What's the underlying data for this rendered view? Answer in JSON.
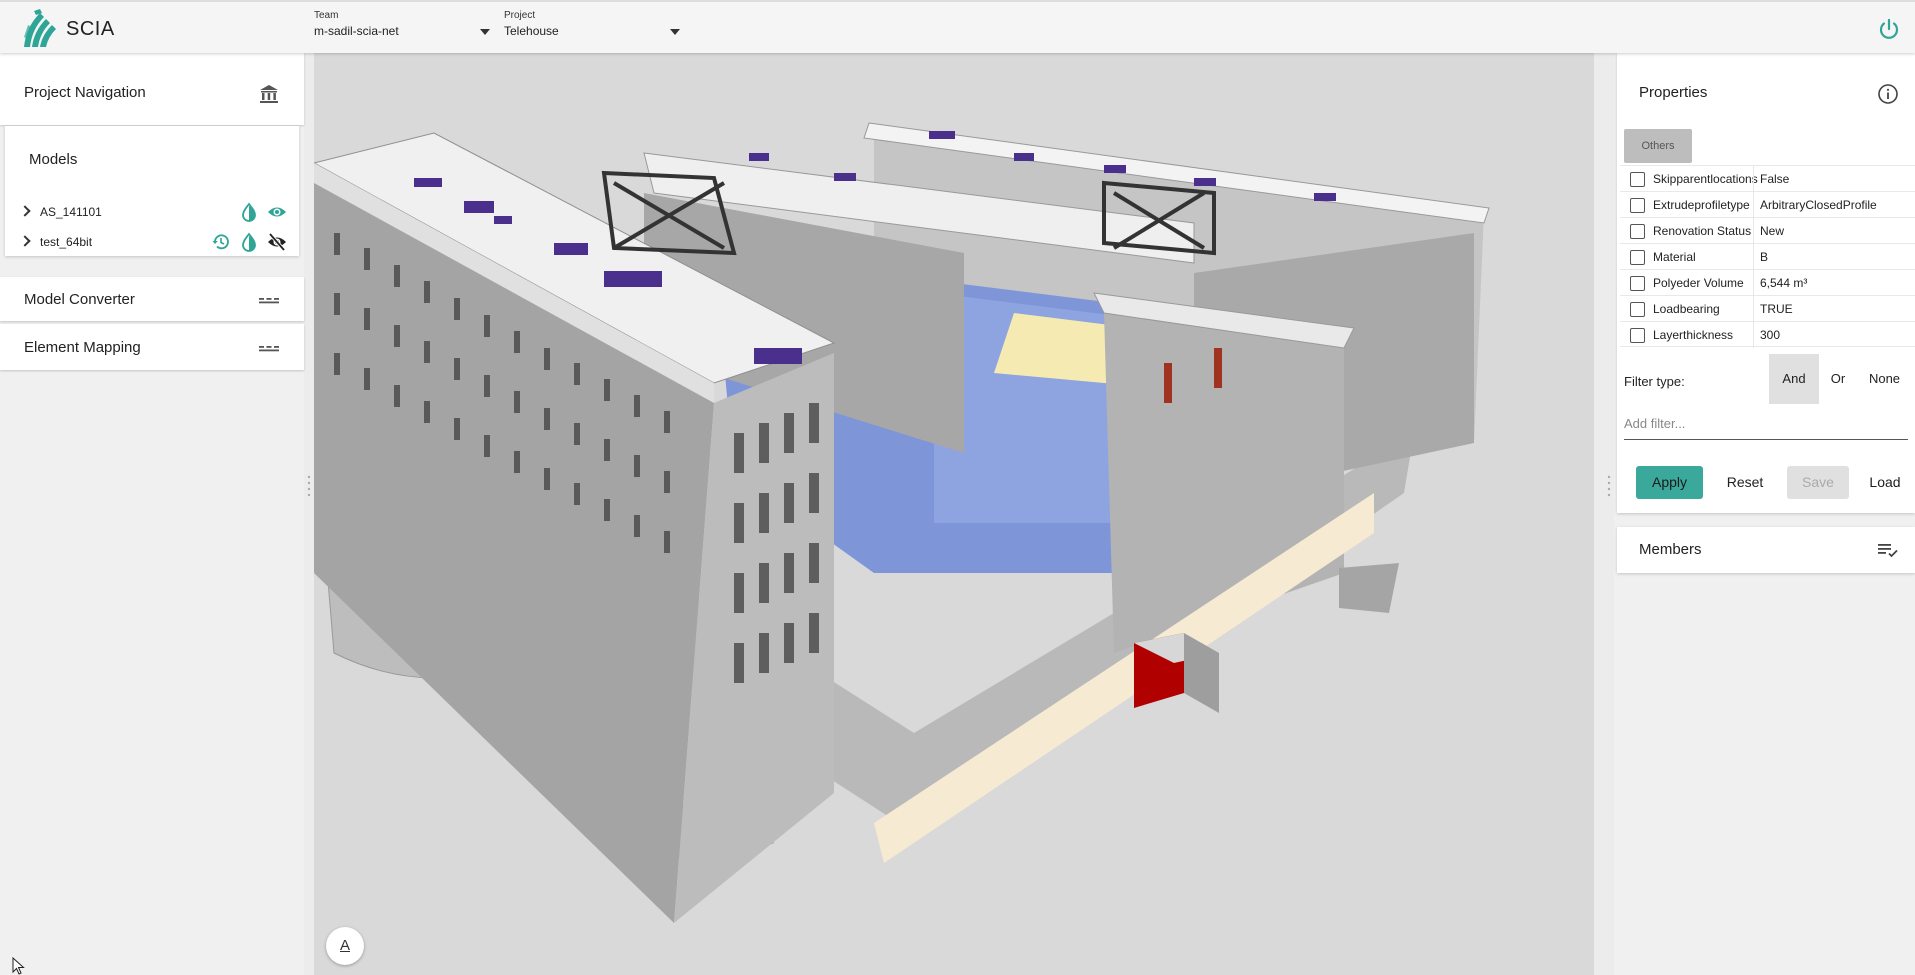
{
  "app": {
    "brand": "SCIA"
  },
  "header": {
    "team_label": "Team",
    "team_value": "m-sadil-scia-net",
    "project_label": "Project",
    "project_value": "Telehouse"
  },
  "left": {
    "project_navigation": "Project Navigation",
    "models_title": "Models",
    "models": [
      {
        "name": "AS_141101"
      },
      {
        "name": "test_64bit"
      }
    ],
    "model_converter": "Model Converter",
    "element_mapping": "Element Mapping"
  },
  "right": {
    "properties_title": "Properties",
    "tab_others": "Others",
    "properties": [
      {
        "name": "Skipparentlocations",
        "value": "False"
      },
      {
        "name": "Extrudeprofiletype",
        "value": "ArbitraryClosedProfile"
      },
      {
        "name": "Renovation Status",
        "value": "New"
      },
      {
        "name": "Material",
        "value": "B"
      },
      {
        "name": "Polyeder Volume",
        "value": "6,544 m³"
      },
      {
        "name": "Loadbearing",
        "value": "TRUE"
      },
      {
        "name": "Layerthickness",
        "value": "300"
      }
    ],
    "filter_type_label": "Filter type:",
    "filter_and": "And",
    "filter_or": "Or",
    "filter_none": "None",
    "add_filter_placeholder": "Add filter...",
    "apply": "Apply",
    "reset": "Reset",
    "save": "Save",
    "load": "Load",
    "members_title": "Members"
  },
  "viewport": {
    "compass_label": "A"
  },
  "colors": {
    "accent": "#3aa99b",
    "viewport_bg": "#d9d9d9"
  }
}
